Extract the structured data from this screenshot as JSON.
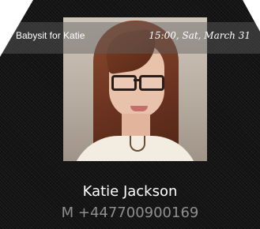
{
  "notification": {
    "title": "Babysit for Katie",
    "time": "15:00, Sat, March 31"
  },
  "contact": {
    "name": "Katie Jackson",
    "phone": "M +447700900169",
    "photo_icon": "contact-photo"
  }
}
